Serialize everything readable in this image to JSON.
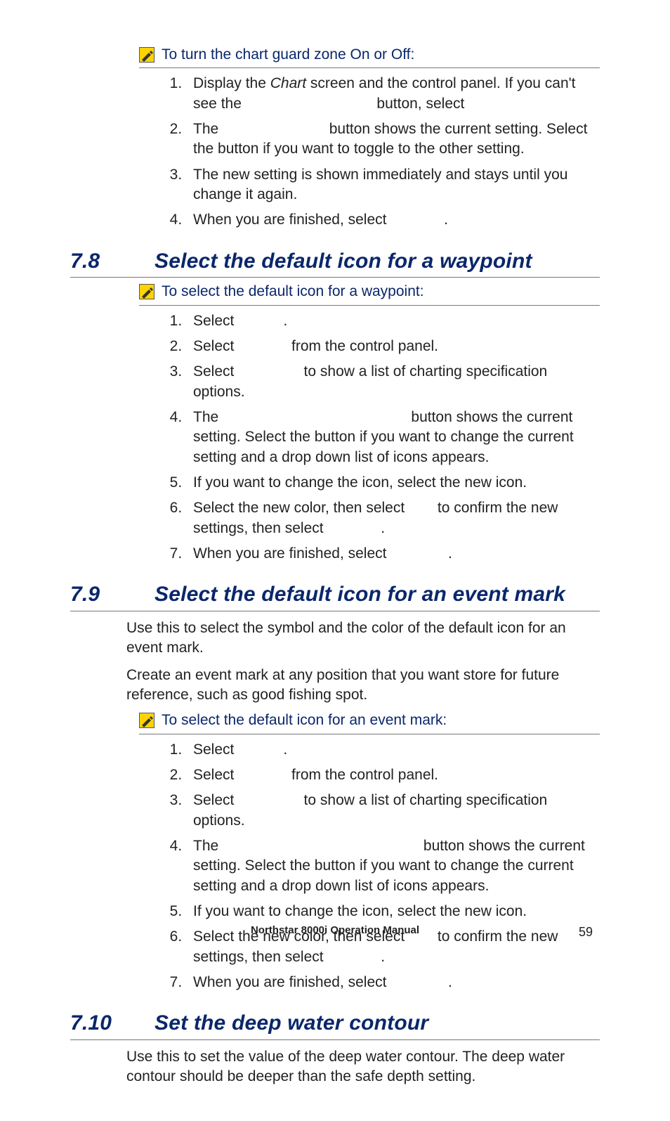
{
  "proc1": {
    "title": "To turn the chart guard zone On or Off:",
    "steps": [
      "Display the <i>Chart</i> screen and the control panel. If you can't see the                                 button, select",
      "The                           button shows the current setting. Select the button if you want to toggle to the other setting.",
      "The new setting is shown immediately and stays until you change it again.",
      "When you are finished, select              ."
    ]
  },
  "sec78": {
    "num": "7.8",
    "title": "Select the default icon for a waypoint",
    "proc_title": "To select the default icon for a waypoint:",
    "steps": [
      "Select            .",
      "Select              from the control panel.",
      "Select                 to show a list of charting specification options.",
      "The                                               button shows the current setting. Select the button if you want to change the current setting and a drop down list of icons appears.",
      "If you want to change the icon, select the new icon.",
      "Select the new color, then select        to confirm the new settings, then select              .",
      "When you are finished, select               ."
    ]
  },
  "sec79": {
    "num": "7.9",
    "title": "Select the default icon for an event mark",
    "para1": "Use this to select the symbol and the color of the default icon for an event mark.",
    "para2": "Create an event mark at any position that you want store for future reference, such as good fishing spot.",
    "proc_title": "To select the default icon for an event mark:",
    "steps": [
      "Select            .",
      "Select              from the control panel.",
      "Select                 to show a list of charting specification options.",
      "The                                                  button shows the current setting. Select the button if you want to change the current setting and a drop down list of icons appears.",
      "If you want to change the icon, select the new icon.",
      "Select the new color, then select        to confirm the new settings, then select              .",
      "When you are finished, select               ."
    ]
  },
  "sec710": {
    "num": "7.10",
    "title": "Set the deep water contour",
    "para": "Use this to set the value of the deep water contour. The deep water contour should be deeper than the safe depth setting."
  },
  "footer": {
    "title": "Northstar 8000i Operation Manual",
    "page": "59"
  }
}
